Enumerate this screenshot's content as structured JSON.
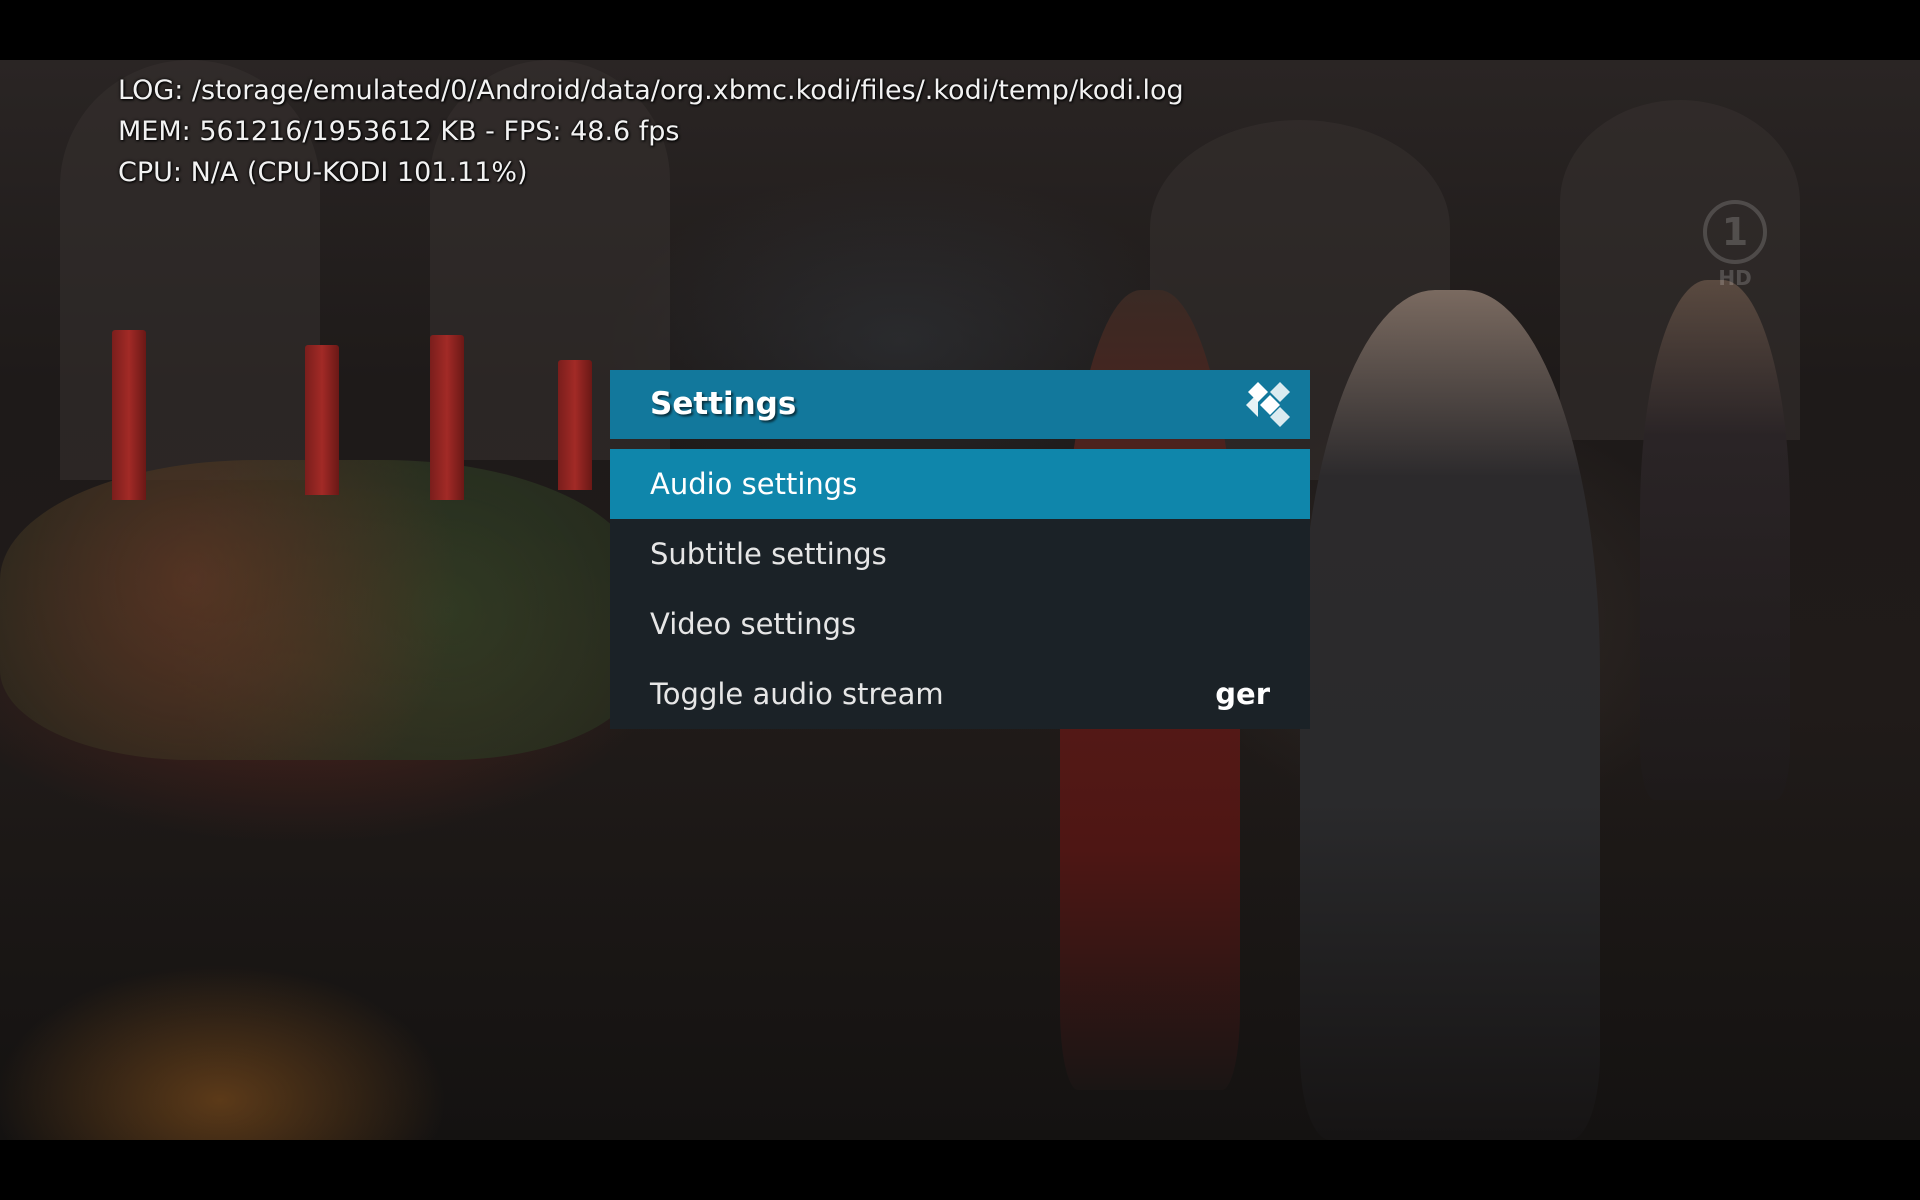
{
  "debug_overlay": {
    "log_line": "LOG: /storage/emulated/0/Android/data/org.xbmc.kodi/files/.kodi/temp/kodi.log",
    "mem_line": "MEM: 561216/1953612 KB - FPS: 48.6 fps",
    "cpu_line": "CPU: N/A (CPU-KODI 101.11%)"
  },
  "channel_logo": {
    "number": "1",
    "label": "HD"
  },
  "dialog": {
    "title": "Settings",
    "logo_icon": "kodi-logo-icon",
    "items": [
      {
        "label": "Audio settings",
        "value": "",
        "focused": true
      },
      {
        "label": "Subtitle settings",
        "value": "",
        "focused": false
      },
      {
        "label": "Video settings",
        "value": "",
        "focused": false
      },
      {
        "label": "Toggle audio stream",
        "value": "ger",
        "focused": false
      }
    ]
  },
  "colors": {
    "header_bg": "#12789c",
    "focused_item_bg": "#0f86ab",
    "body_bg": "#1b2227"
  }
}
